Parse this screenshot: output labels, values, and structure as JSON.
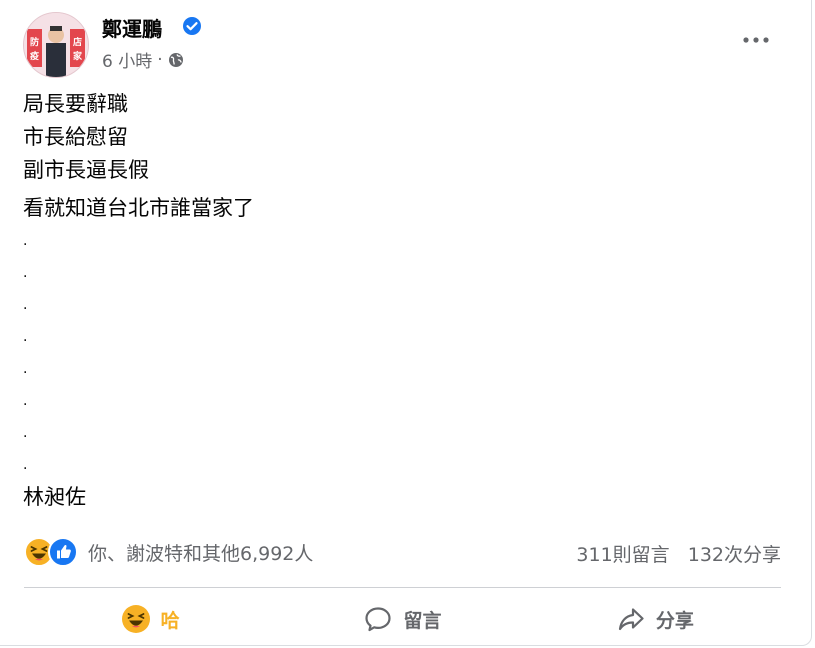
{
  "post": {
    "author": "鄭運鵬",
    "timestamp": "6 小時",
    "separator": "·",
    "lines": [
      "局長要辭職",
      "市長給慰留",
      "副市長逼長假"
    ],
    "line2": "看就知道台北市誰當家了",
    "dots": [
      ".",
      ".",
      ".",
      ".",
      ".",
      ".",
      ".",
      "."
    ],
    "closing": "林昶佐"
  },
  "reactions": {
    "summary": "你、謝波特和其他6,992人",
    "comments": "311則留言",
    "shares": "132次分享"
  },
  "actions": {
    "haha_label": "哈",
    "comment_label": "留言",
    "share_label": "分享"
  },
  "avatar_sign_text": [
    "防",
    "疫",
    "店",
    "家"
  ],
  "colors": {
    "haha": "#f7b125",
    "like": "#1877f2",
    "verified": "#1877f2",
    "secondary_text": "#65676b"
  }
}
